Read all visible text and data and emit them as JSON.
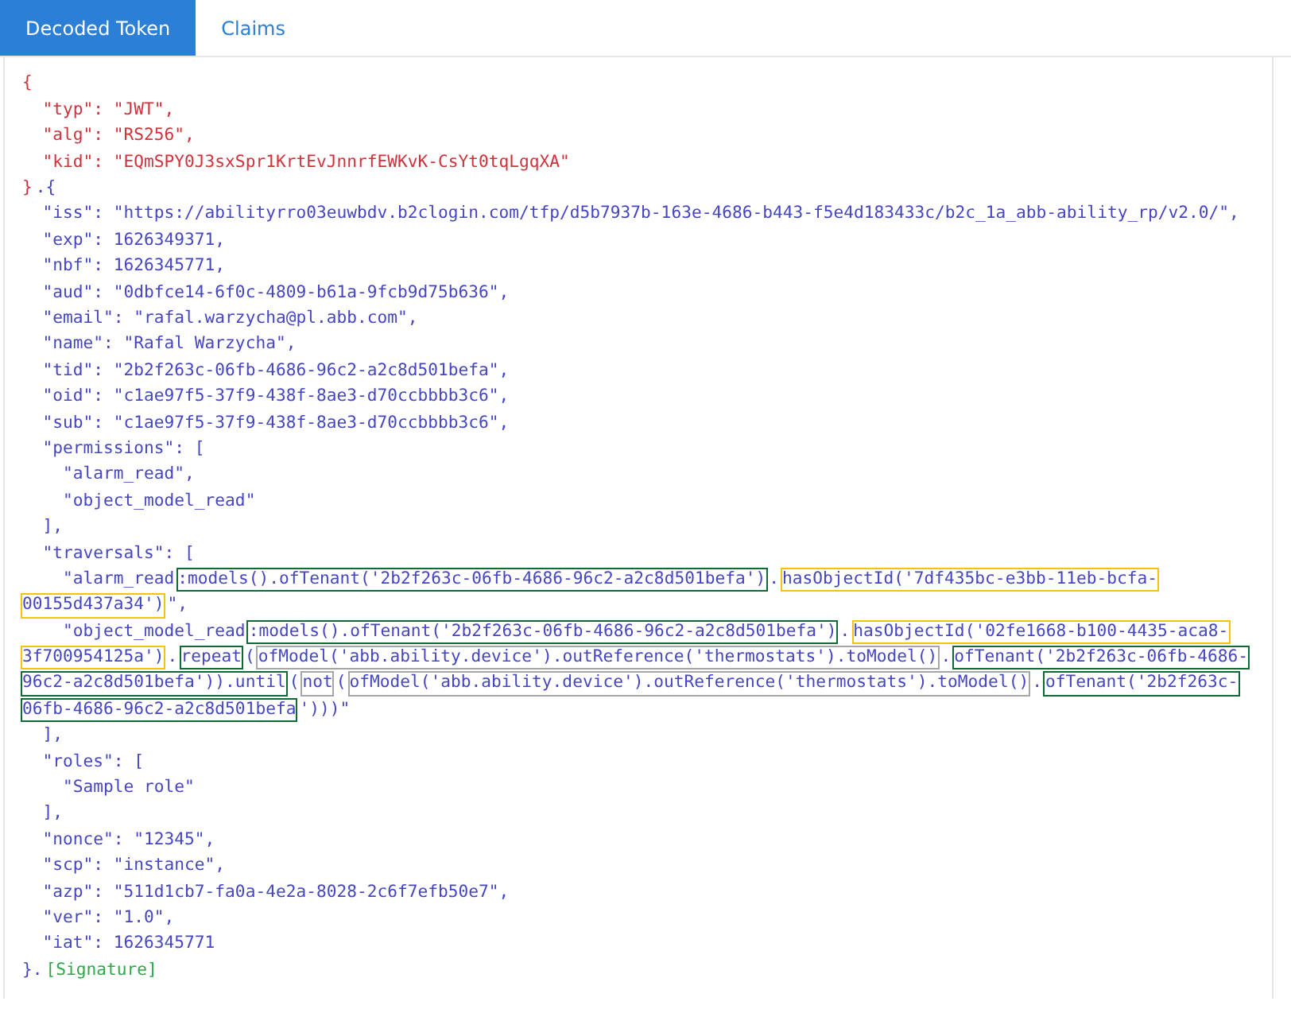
{
  "tabs": [
    {
      "label": "Decoded Token",
      "selected": true
    },
    {
      "label": "Claims",
      "selected": false
    }
  ],
  "token_lines": [
    {
      "segments": [
        {
          "text": "{",
          "kind": "header"
        }
      ]
    },
    {
      "segments": [
        {
          "text": "  \"typ\": \"JWT\",",
          "kind": "header"
        }
      ]
    },
    {
      "segments": [
        {
          "text": "  \"alg\": \"RS256\",",
          "kind": "header"
        }
      ]
    },
    {
      "segments": [
        {
          "text": "  \"kid\": \"EQmSPY0J3sxSpr1KrtEvJnnrfEWKvK-CsYt0tqLgqXA\"",
          "kind": "header"
        }
      ]
    },
    {
      "segments": [
        {
          "text": "}",
          "kind": "header"
        },
        {
          "text": ".{",
          "kind": "payload"
        }
      ]
    },
    {
      "segments": [
        {
          "text": "  \"iss\": \"https://abilityrro03euwbdv.b2clogin.com/tfp/d5b7937b-163e-4686-b443-f5e4d183433c/b2c_1a_abb-ability_rp/v2.0/\",",
          "kind": "payload"
        }
      ]
    },
    {
      "segments": [
        {
          "text": "  \"exp\": 1626349371,",
          "kind": "payload"
        }
      ]
    },
    {
      "segments": [
        {
          "text": "  \"nbf\": 1626345771,",
          "kind": "payload"
        }
      ]
    },
    {
      "segments": [
        {
          "text": "  \"aud\": \"0dbfce14-6f0c-4809-b61a-9fcb9d75b636\",",
          "kind": "payload"
        }
      ]
    },
    {
      "segments": [
        {
          "text": "  \"email\": \"rafal.warzycha@pl.abb.com\",",
          "kind": "payload"
        }
      ]
    },
    {
      "segments": [
        {
          "text": "  \"name\": \"Rafal Warzycha\",",
          "kind": "payload"
        }
      ]
    },
    {
      "segments": [
        {
          "text": "  \"tid\": \"2b2f263c-06fb-4686-96c2-a2c8d501befa\",",
          "kind": "payload"
        }
      ]
    },
    {
      "segments": [
        {
          "text": "  \"oid\": \"c1ae97f5-37f9-438f-8ae3-d70ccbbbb3c6\",",
          "kind": "payload"
        }
      ]
    },
    {
      "segments": [
        {
          "text": "  \"sub\": \"c1ae97f5-37f9-438f-8ae3-d70ccbbbb3c6\",",
          "kind": "payload"
        }
      ]
    },
    {
      "segments": [
        {
          "text": "  \"permissions\": [",
          "kind": "payload"
        }
      ]
    },
    {
      "segments": [
        {
          "text": "    \"alarm_read\",",
          "kind": "payload"
        }
      ]
    },
    {
      "segments": [
        {
          "text": "    \"object_model_read\"",
          "kind": "payload"
        }
      ]
    },
    {
      "segments": [
        {
          "text": "  ],",
          "kind": "payload"
        }
      ]
    },
    {
      "segments": [
        {
          "text": "  \"traversals\": [",
          "kind": "payload"
        }
      ]
    },
    {
      "segments": [
        {
          "text": "    \"alarm_read",
          "kind": "payload"
        },
        {
          "text": ":models().ofTenant('2b2f263c-06fb-4686-96c2-a2c8d501befa')",
          "kind": "payload",
          "color": "#0e6b33"
        },
        {
          "text": ".",
          "kind": "payload"
        },
        {
          "text": "hasObjectId('7df435bc-e3bb-11eb-bcfa-",
          "kind": "payload",
          "color": "#f2c40f"
        }
      ]
    },
    {
      "segments": [
        {
          "text": "00155d437a34')",
          "kind": "payload",
          "color": "#f2c40f"
        },
        {
          "text": "\",",
          "kind": "payload"
        }
      ]
    },
    {
      "segments": [
        {
          "text": "    \"object_model_read",
          "kind": "payload"
        },
        {
          "text": ":models().ofTenant('2b2f263c-06fb-4686-96c2-a2c8d501befa')",
          "kind": "payload",
          "color": "#0e6b33"
        },
        {
          "text": ".",
          "kind": "payload"
        },
        {
          "text": "hasObjectId('02fe1668-b100-4435-aca8-",
          "kind": "payload",
          "color": "#f2c40f"
        }
      ]
    },
    {
      "segments": [
        {
          "text": "3f700954125a')",
          "kind": "payload",
          "color": "#f2c40f"
        },
        {
          "text": ".",
          "kind": "payload"
        },
        {
          "text": "repeat",
          "kind": "payload",
          "color": "#0e6b33"
        },
        {
          "text": "(",
          "kind": "payload"
        },
        {
          "text": "ofModel('abb.ability.device').outReference('thermostats').toModel()",
          "kind": "payload",
          "color": "#a6a6a6"
        },
        {
          "text": ".",
          "kind": "payload"
        },
        {
          "text": "ofTenant('2b2f263c-06fb-4686-",
          "kind": "payload",
          "color": "#0e6b33"
        }
      ]
    },
    {
      "segments": [
        {
          "text": "96c2-a2c8d501befa')).until",
          "kind": "payload",
          "color": "#0e6b33"
        },
        {
          "text": "(",
          "kind": "payload"
        },
        {
          "text": "not",
          "kind": "payload",
          "color": "#a6a6a6"
        },
        {
          "text": "(",
          "kind": "payload"
        },
        {
          "text": "ofModel('abb.ability.device').outReference('thermostats').toModel()",
          "kind": "payload",
          "color": "#a6a6a6"
        },
        {
          "text": ".",
          "kind": "payload"
        },
        {
          "text": "ofTenant('2b2f263c-",
          "kind": "payload",
          "color": "#0e6b33"
        }
      ]
    },
    {
      "segments": [
        {
          "text": "06fb-4686-96c2-a2c8d501befa",
          "kind": "payload",
          "color": "#0e6b33"
        },
        {
          "text": "')))\"",
          "kind": "payload"
        }
      ]
    },
    {
      "segments": [
        {
          "text": "  ],",
          "kind": "payload"
        }
      ]
    },
    {
      "segments": [
        {
          "text": "  \"roles\": [",
          "kind": "payload"
        }
      ]
    },
    {
      "segments": [
        {
          "text": "    \"Sample role\"",
          "kind": "payload"
        }
      ]
    },
    {
      "segments": [
        {
          "text": "  ],",
          "kind": "payload"
        }
      ]
    },
    {
      "segments": [
        {
          "text": "  \"nonce\": \"12345\",",
          "kind": "payload"
        }
      ]
    },
    {
      "segments": [
        {
          "text": "  \"scp\": \"instance\",",
          "kind": "payload"
        }
      ]
    },
    {
      "segments": [
        {
          "text": "  \"azp\": \"511d1cb7-fa0a-4e2a-8028-2c6f7efb50e7\",",
          "kind": "payload"
        }
      ]
    },
    {
      "segments": [
        {
          "text": "  \"ver\": \"1.0\",",
          "kind": "payload"
        }
      ]
    },
    {
      "segments": [
        {
          "text": "  \"iat\": 1626345771",
          "kind": "payload"
        }
      ]
    },
    {
      "segments": [
        {
          "text": "}.",
          "kind": "payload"
        },
        {
          "text": "[Signature]",
          "kind": "signature"
        }
      ]
    }
  ]
}
